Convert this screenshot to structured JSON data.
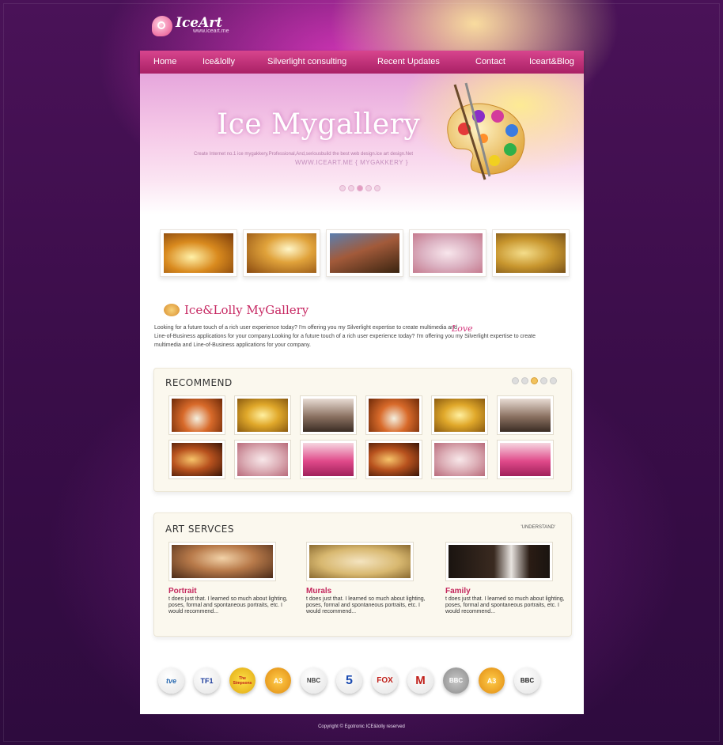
{
  "logo": {
    "name": "IceArt",
    "url": "www.iceart.me"
  },
  "nav": [
    "Home",
    "Ice&lolly",
    "Silverlight consulting",
    "Recent Updates",
    "Contact",
    "Iceart&Blog"
  ],
  "hero": {
    "title": "Ice Mygallery",
    "tagline": "Create Internet no.1 ice mygakkery,Professional,And,seriousbuild the best web design.ice art design.Net",
    "url": "WWW.ICEART.ME { MYGAKKERY }",
    "slides": 5,
    "active_slide": 3
  },
  "gallery": {
    "title": "Ice&Lolly MyGallery",
    "intro_1": "Looking for a future touch of a rich user experience today? I'm offering you my Silverlight expertise to create multimedia and",
    "intro_2": "Line-of-Business applications for your company.Looking for a future touch of a rich user experience today? I'm offering you my Silverlight expertise to create",
    "intro_3": "multimedia and Line-of-Business applications for your company.",
    "annotation": "Love"
  },
  "recommend": {
    "title": "RECOMMEND",
    "pages": 5,
    "active_page": 3
  },
  "services": {
    "title": "ART SERVCES",
    "link": "'UNDERSTAND'",
    "items": [
      {
        "title": "Portrait",
        "text": "t does just that. I learned so much about lighting, poses, formal and spontaneous portraits, etc. I would recommend..."
      },
      {
        "title": "Murals",
        "text": "t does just that. I learned so much about lighting, poses, formal and spontaneous portraits, etc. I would recommend..."
      },
      {
        "title": "Family",
        "text": "t does just that. I learned so much about lighting, poses, formal and spontaneous portraits, etc. I would recommend..."
      }
    ]
  },
  "partners": [
    "tve",
    "TF1",
    "The Simpsons",
    "A3",
    "NBC",
    "5",
    "FOX",
    "M",
    "BBC",
    "A3",
    "BBC"
  ],
  "footer": {
    "copyright": "Copyright © Egotronic ICE&lolly reserved"
  }
}
